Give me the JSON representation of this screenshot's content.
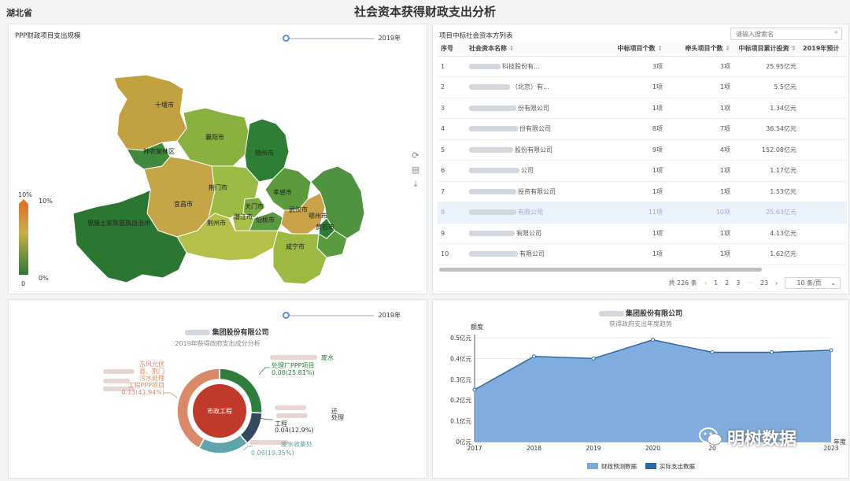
{
  "header": {
    "region": "湖北省",
    "title": "社会资本获得财政支出分析"
  },
  "map_panel": {
    "title": "PPP财政项目支出规模",
    "year": "2019年",
    "legend": {
      "top_label": "10%",
      "top_right_label": "10%",
      "bottom_label": "0",
      "bottom_right_label": "0%"
    },
    "cities": [
      "十堰市",
      "神农架林区",
      "襄阳市",
      "随州市",
      "宜昌市",
      "荆门市",
      "孝感市",
      "天门市",
      "潜江市",
      "仙桃市",
      "荆州市",
      "武汉市",
      "鄂州市",
      "黄石市",
      "咸宁市",
      "恩施土家族苗族自治州"
    ]
  },
  "table_panel": {
    "title": "项目中标社会资本方列表",
    "search_placeholder": "请输入搜索名",
    "headers": [
      "序号",
      "社会资本名称",
      "中标项目个数",
      "牵头项目个数",
      "中标项目累计投资",
      "2019年预计"
    ],
    "rows": [
      {
        "idx": "1",
        "name_a": "",
        "name_b": "科技股份有...",
        "bids": "3项",
        "lead": "3项",
        "invest": "25.95亿元"
      },
      {
        "idx": "2",
        "name_a": "",
        "name_b": "（北京）有...",
        "bids": "1项",
        "lead": "1项",
        "invest": "5.5亿元"
      },
      {
        "idx": "3",
        "name_a": "",
        "name_b": "份有限公司",
        "bids": "1项",
        "lead": "1项",
        "invest": "1.34亿元"
      },
      {
        "idx": "4",
        "name_a": "",
        "name_b": "份有限公司",
        "bids": "8项",
        "lead": "7项",
        "invest": "36.54亿元"
      },
      {
        "idx": "5",
        "name_a": "",
        "name_b": "股份有限公司",
        "bids": "9项",
        "lead": "4项",
        "invest": "152.08亿元"
      },
      {
        "idx": "6",
        "name_a": "",
        "name_b": "公司",
        "bids": "1项",
        "lead": "1项",
        "invest": "1.17亿元"
      },
      {
        "idx": "7",
        "name_a": "",
        "name_b": "投资有限公司",
        "bids": "1项",
        "lead": "1项",
        "invest": "1.53亿元"
      },
      {
        "idx": "8",
        "name_a": "",
        "name_b": "有限公司",
        "bids": "11项",
        "lead": "10项",
        "invest": "25.63亿元"
      },
      {
        "idx": "9",
        "name_a": "",
        "name_b": "有限公司",
        "bids": "1项",
        "lead": "1项",
        "invest": "4.13亿元"
      },
      {
        "idx": "10",
        "name_a": "",
        "name_b": "有限公司",
        "bids": "1项",
        "lead": "1项",
        "invest": "1.62亿元"
      }
    ],
    "pager": {
      "total": "共 226 条",
      "pages": [
        "1",
        "2",
        "3",
        "···",
        "23"
      ],
      "prev": "‹",
      "next": "›",
      "page_size": "10 条/页"
    }
  },
  "donut_panel": {
    "title": "集团股份有限公司",
    "subtitle": "2019年获得政府支出成分分析",
    "year": "2019年",
    "center_label": "市政工程",
    "labels": {
      "green_line1": "废水",
      "green_line2": "处理厂PPP项目",
      "green_value": "0.08(25.81%)",
      "dark_line1": "还",
      "dark_line2": "处理",
      "dark_line3": "工程",
      "dark_value": "0.04(12.9%)",
      "teal_line1": "废水收集处",
      "teal_value": "0.06(19.35%)",
      "orange_line1": "东风光伏",
      "orange_line2": "县、荆门",
      "orange_line3": "污水处理",
      "orange_line4": "工程PPP项目",
      "orange_value": "0.13(41.94%)"
    }
  },
  "line_panel": {
    "title": "集团股份有限公司",
    "subtitle": "获得政府支出年度趋势",
    "ylabel": "额度",
    "xlabel": "年度",
    "legend": [
      "财政预测数据",
      "实际支出数据"
    ]
  },
  "watermark": "明树数据",
  "colors": {
    "accent": "#1f6fd1",
    "area": "#7aa9dc",
    "line": "#2b6aa5",
    "donut_orange": "#d98a6a",
    "donut_green": "#2f7d3c",
    "donut_dark": "#34495e",
    "donut_teal": "#5fa3ab",
    "donut_center": "#c0392b"
  },
  "chart_data": [
    {
      "type": "pie",
      "title": "2019年获得政府支出成分分析",
      "values": [
        0.08,
        0.04,
        0.06,
        0.13
      ],
      "percent": [
        25.81,
        12.9,
        19.35,
        41.94
      ],
      "units": ""
    },
    {
      "type": "area",
      "title": "获得政府支出年度趋势",
      "xlabel": "年度",
      "ylabel": "额度",
      "x": [
        "2017",
        "2018",
        "2019",
        "2020",
        "2021",
        "2022",
        "2023"
      ],
      "x_tick_labels": [
        "2017",
        "2018",
        "2019",
        "2020",
        "20",
        "",
        "2023"
      ],
      "series": [
        {
          "name": "财政预测数据",
          "values": [
            0.25,
            0.41,
            0.4,
            0.49,
            0.43,
            0.43,
            0.44
          ]
        }
      ],
      "ylim": [
        0,
        0.5
      ],
      "yticks": [
        "0亿元",
        "0.1亿元",
        "0.2亿元",
        "0.3亿元",
        "0.4亿元",
        "0.5亿元"
      ],
      "grid": true,
      "legend_position": "bottom"
    }
  ]
}
